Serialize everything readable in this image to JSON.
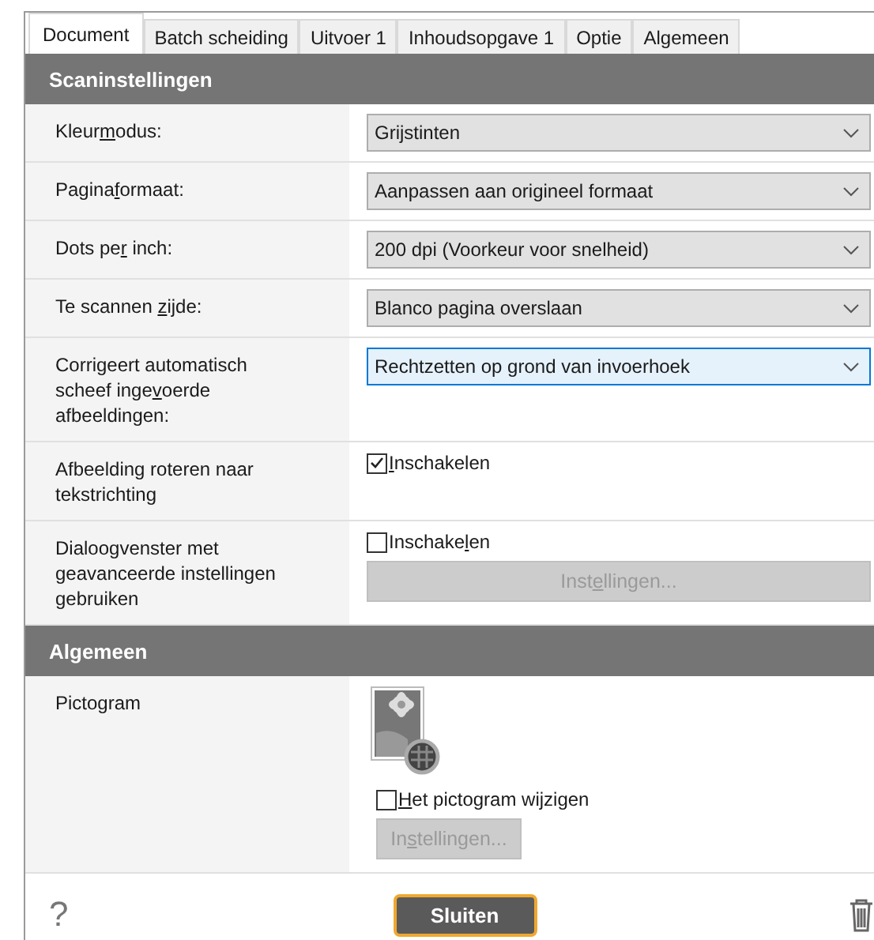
{
  "tabs": [
    {
      "label": "Document",
      "selected": true
    },
    {
      "label": "Batch scheiding",
      "selected": false
    },
    {
      "label": "Uitvoer 1",
      "selected": false
    },
    {
      "label": "Inhoudsopgave 1",
      "selected": false
    },
    {
      "label": "Optie",
      "selected": false
    },
    {
      "label": "Algemeen",
      "selected": false
    }
  ],
  "sections": [
    {
      "title": "Scaninstellingen",
      "rows": [
        {
          "kind": "select",
          "label": {
            "pre": "Kleur",
            "key": "m",
            "post": "odus:"
          },
          "value": "Grijstinten",
          "focused": false
        },
        {
          "kind": "select",
          "label": {
            "pre": "Pagina",
            "key": "f",
            "post": "ormaat:"
          },
          "value": "Aanpassen aan origineel formaat",
          "focused": false
        },
        {
          "kind": "select",
          "label": {
            "pre": "Dots pe",
            "key": "r",
            "post": " inch:"
          },
          "value": "200 dpi (Voorkeur voor snelheid)",
          "focused": false
        },
        {
          "kind": "select",
          "label": {
            "pre": "Te scannen ",
            "key": "z",
            "post": "ijde:"
          },
          "value": "Blanco pagina overslaan",
          "focused": false
        },
        {
          "kind": "select",
          "label": {
            "pre": "Corrigeert automatisch scheef inge",
            "key": "v",
            "post": "oerde afbeeldingen:"
          },
          "value": "Rechtzetten op grond van invoerhoek",
          "focused": true
        },
        {
          "kind": "checkbox",
          "label": {
            "pre": "Afbeelding roteren naar tekstrichting"
          },
          "check": {
            "key": "I",
            "post": "nschakelen"
          },
          "checked": true
        },
        {
          "kind": "checkbox",
          "label": {
            "pre": "Dialoogvenster met geavanceerde instellingen gebruiken"
          },
          "check": {
            "pre": "Inschake",
            "key": "l",
            "post": "en"
          },
          "checked": false,
          "button": {
            "pre": "Inst",
            "key": "e",
            "post": "llingen..."
          },
          "button_disabled": true
        }
      ]
    },
    {
      "title": "Algemeen",
      "rows": [
        {
          "kind": "icon",
          "label": {
            "pre": "Pictogram"
          },
          "check": {
            "key": "H",
            "post": "et pictogram wijzigen"
          },
          "checked": false,
          "button": {
            "pre": "In",
            "key": "s",
            "post": "tellingen..."
          },
          "button_disabled": true
        }
      ]
    }
  ],
  "footer": {
    "help": "?",
    "close": "Sluiten"
  }
}
